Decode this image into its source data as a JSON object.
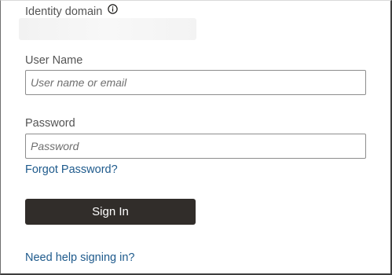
{
  "identity_domain": {
    "label": "Identity domain",
    "info_icon": "info-circle-icon",
    "value": ""
  },
  "username": {
    "label": "User Name",
    "placeholder": "User name or email",
    "value": ""
  },
  "password": {
    "label": "Password",
    "placeholder": "Password",
    "value": ""
  },
  "links": {
    "forgot_password": "Forgot Password?",
    "help": "Need help signing in?"
  },
  "signin": {
    "label": "Sign In"
  },
  "colors": {
    "button_bg": "#312d2a",
    "link": "#1e5a8c",
    "label": "#545454"
  }
}
